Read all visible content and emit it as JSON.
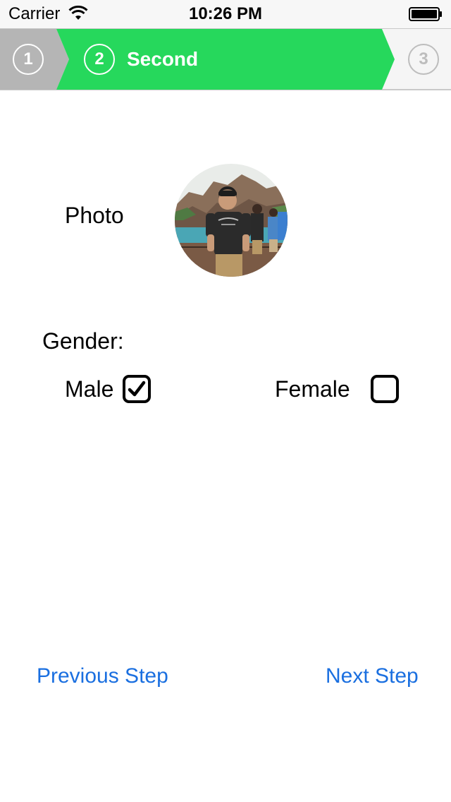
{
  "status_bar": {
    "carrier": "Carrier",
    "time": "10:26 PM",
    "wifi_icon": "wifi-icon",
    "battery_icon": "battery-icon"
  },
  "stepper": {
    "steps": [
      {
        "number": "1",
        "label": "",
        "state": "completed"
      },
      {
        "number": "2",
        "label": "Second",
        "state": "active"
      },
      {
        "number": "3",
        "label": "",
        "state": "pending"
      }
    ],
    "colors": {
      "completed": "#b5b5b5",
      "active": "#26d85c",
      "pending": "#f5f5f5"
    }
  },
  "form": {
    "photo_label": "Photo",
    "gender_label": "Gender:",
    "options": [
      {
        "label": "Male",
        "checked": true
      },
      {
        "label": "Female",
        "checked": false
      }
    ]
  },
  "navigation": {
    "previous_label": "Previous Step",
    "next_label": "Next Step",
    "link_color": "#1a6fe0"
  }
}
